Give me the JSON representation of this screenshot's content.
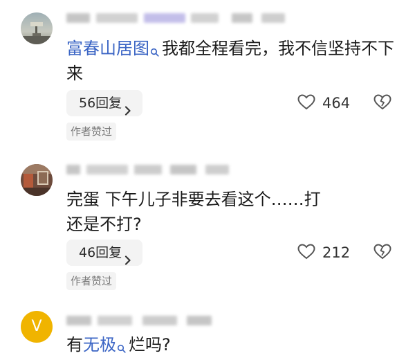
{
  "comments": [
    {
      "avatar": "landscape-photo-avatar",
      "text_link": "富春山居图",
      "text_rest": "我都全程看完，我不信坚持不下来",
      "reply_label": "56回复",
      "likes": "464",
      "author_liked": "作者赞过"
    },
    {
      "avatar": "room-photo-avatar",
      "text": "完蛋 下午儿子非要去看这个……打还是不打?",
      "reply_label": "46回复",
      "likes": "212",
      "author_liked": "作者赞过"
    },
    {
      "avatar": "v-letter-avatar",
      "avatar_letter": "V",
      "text_prefix": "有",
      "text_link": "无极",
      "text_suffix": "烂吗?"
    }
  ],
  "icons": {
    "reply_chevron": "chevron-right-icon",
    "like": "heart-outline-icon",
    "dislike": "broken-heart-icon",
    "search_hint": "search-icon"
  },
  "colors": {
    "link": "#3a64c4",
    "avatar_v": "#f0b400",
    "pill_bg": "#f3f3f3"
  }
}
